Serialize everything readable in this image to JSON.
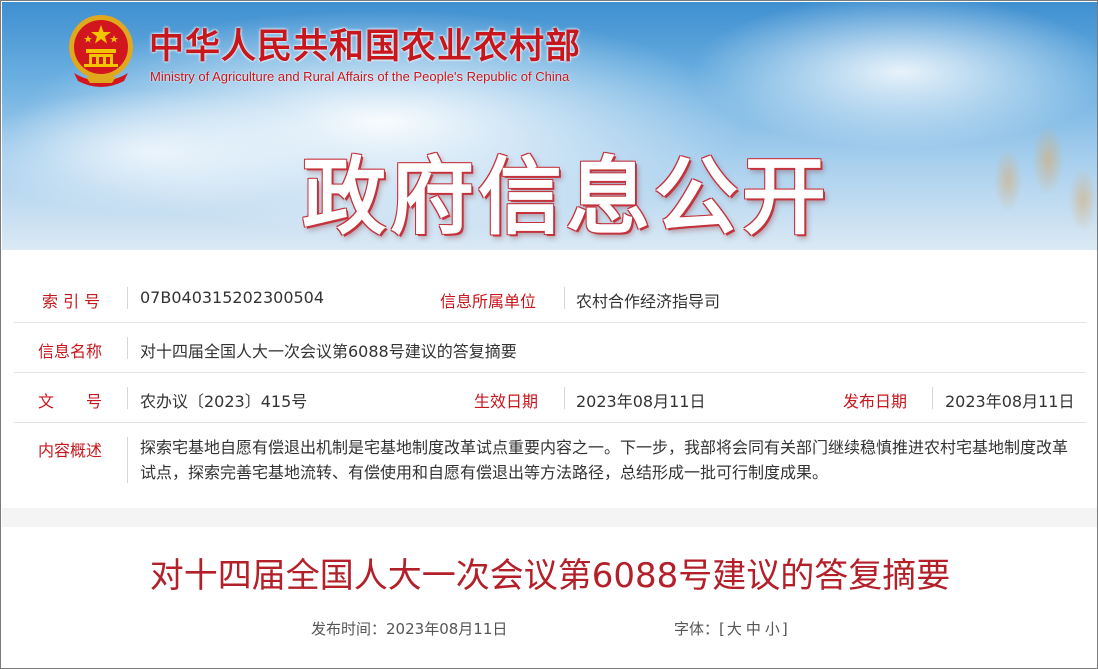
{
  "header": {
    "ministry_cn": "中华人民共和国农业农村部",
    "ministry_en": "Ministry of Agriculture and Rural Affairs of the People's Republic of China",
    "banner_title": "政府信息公开",
    "accent_color": "#c8161d"
  },
  "info": {
    "index_label": "索 引 号",
    "index_value": "07B040315202300504",
    "unit_label": "信息所属单位",
    "unit_value": "农村合作经济指导司",
    "name_label": "信息名称",
    "name_value": "对十四届全国人大一次会议第6088号建议的答复摘要",
    "doc_no_label": "文　　号",
    "doc_no_value": "农办议〔2023〕415号",
    "effective_label": "生效日期",
    "effective_value": "2023年08月11日",
    "publish_label": "发布日期",
    "publish_value": "2023年08月11日",
    "summary_label": "内容概述",
    "summary_value": "探索宅基地自愿有偿退出机制是宅基地制度改革试点重要内容之一。下一步，我部将会同有关部门继续稳慎推进农村宅基地制度改革试点，探索完善宅基地流转、有偿使用和自愿有偿退出等方法路径，总结形成一批可行制度成果。"
  },
  "article": {
    "title": "对十四届全国人大一次会议第6088号建议的答复摘要",
    "publish_time_label": "发布时间：",
    "publish_time_value": "2023年08月11日",
    "font_label": "字体：",
    "font_open": "[",
    "font_large": "大",
    "font_medium": "中",
    "font_small": "小",
    "font_close": "]"
  }
}
